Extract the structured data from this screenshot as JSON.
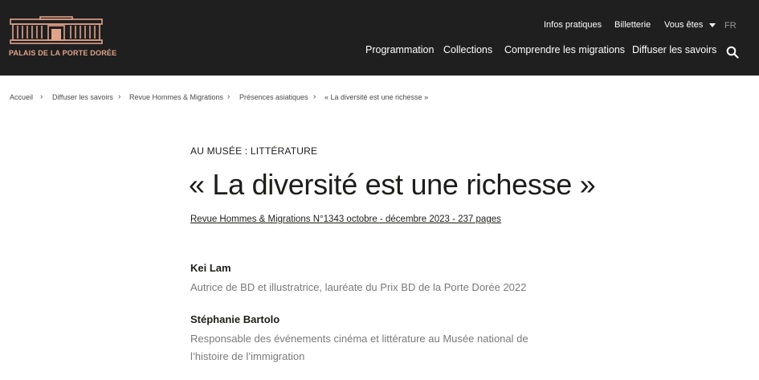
{
  "header": {
    "logo_text": "PALAIS DE LA PORTE DORÉE",
    "utility_nav": {
      "infos": "Infos pratiques",
      "billetterie": "Billetterie",
      "vous_etes": "Vous êtes",
      "lang": "FR"
    },
    "main_nav": {
      "programmation": "Programmation",
      "collections": "Collections",
      "comprendre": "Comprendre les migrations",
      "diffuser": "Diffuser les savoirs"
    }
  },
  "breadcrumb": {
    "items": [
      "Accueil",
      "Diffuser les savoirs",
      "Revue Hommes & Migrations",
      "Présences asiatiques",
      "« La diversité est une richesse »"
    ],
    "separator": "›"
  },
  "article": {
    "kicker": "AU MUSÉE : LITTÉRATURE",
    "title": "« La diversité est une richesse »",
    "source": "Revue Hommes & Migrations N°1343 octobre - décembre 2023 - 237 pages",
    "authors": [
      {
        "name": "Kei Lam",
        "role": "Autrice de BD et illustratrice, lauréate du Prix BD de la Porte Dorée 2022"
      },
      {
        "name": "Stéphanie Bartolo",
        "role": "Responsable des événements cinéma et littérature au Musée national de l’histoire de l’immigration"
      }
    ]
  },
  "colors": {
    "header_bg": "#1f1f1f",
    "logo_accent": "#e0a38a",
    "text": "#1d1d1b",
    "muted_text": "#7a7a7a"
  }
}
